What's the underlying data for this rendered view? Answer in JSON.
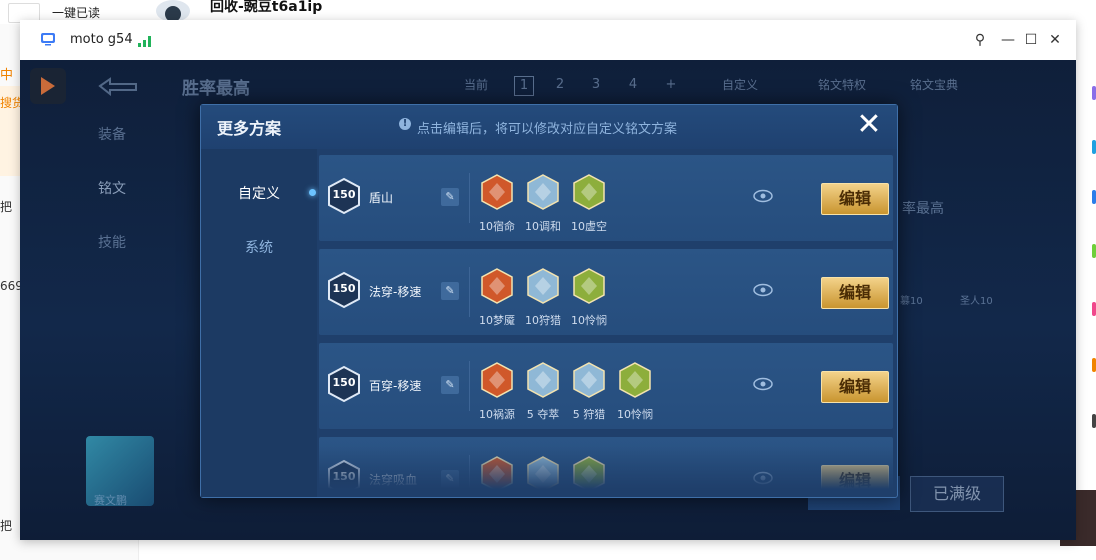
{
  "background": {
    "left_tab": "中",
    "left_texts": [
      "搜货",
      "把",
      "669",
      "把"
    ],
    "top_left_label": "一键已读",
    "top_user": "回收-豌豆t6a1ip"
  },
  "window": {
    "title": "moto g54"
  },
  "game": {
    "header_title": "胜率最高",
    "nav": [
      "装备",
      "铭文",
      "技能"
    ],
    "current_label": "当前",
    "pages": [
      "1",
      "2",
      "3",
      "4",
      "+"
    ],
    "custom_label": "自定义",
    "rune_feature": "铭文特权",
    "rune_book": "铭文宝典",
    "winrate_label": "率最高",
    "side_rune_labels": [
      "篡10",
      "圣人10"
    ],
    "avatar_name": "赛文鹏",
    "btn_done": "已满级"
  },
  "modal": {
    "title": "更多方案",
    "hint": "点击编辑后，将可以修改对应自定义铭文方案",
    "tabs": [
      "自定义",
      "系统"
    ],
    "edit_label": "编辑",
    "rows": [
      {
        "level": "150",
        "name": "盾山",
        "runes": [
          {
            "label": "10宿命",
            "color": "#d0582a"
          },
          {
            "label": "10调和",
            "color": "#8fb8d6"
          },
          {
            "label": "10虚空",
            "color": "#8dae3c"
          }
        ]
      },
      {
        "level": "150",
        "name": "法穿-移速",
        "runes": [
          {
            "label": "10梦魇",
            "color": "#d0582a"
          },
          {
            "label": "10狩猎",
            "color": "#8fb8d6"
          },
          {
            "label": "10怜悯",
            "color": "#8dae3c"
          }
        ]
      },
      {
        "level": "150",
        "name": "百穿-移速",
        "runes": [
          {
            "label": "10祸源",
            "color": "#d0582a"
          },
          {
            "label": "5 夺萃",
            "color": "#8fb8d6"
          },
          {
            "label": "5 狩猎",
            "color": "#8fb8d6"
          },
          {
            "label": "10怜悯",
            "color": "#8dae3c"
          }
        ]
      },
      {
        "level": "150",
        "name": "法穿吸血",
        "runes": [
          {
            "label": "",
            "color": "#d0582a"
          },
          {
            "label": "",
            "color": "#8fb8d6"
          },
          {
            "label": "",
            "color": "#8dae3c"
          }
        ]
      }
    ]
  }
}
